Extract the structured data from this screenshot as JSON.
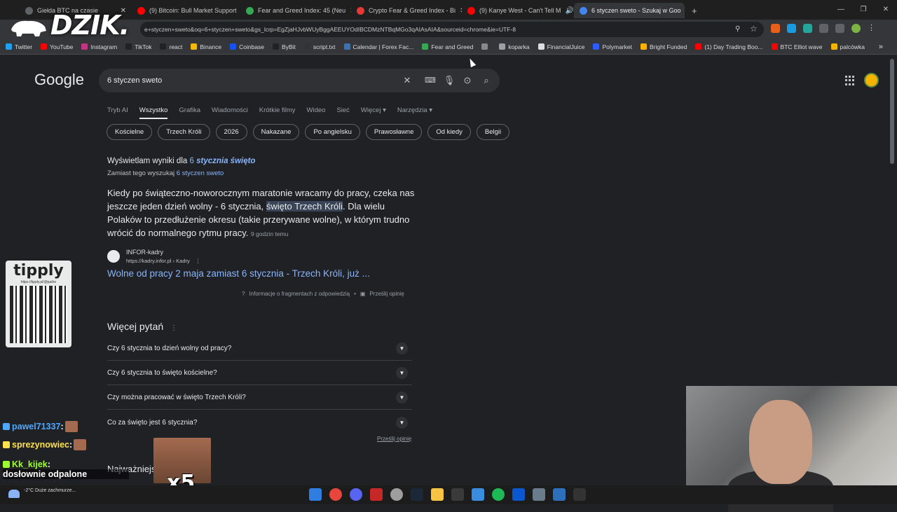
{
  "browser": {
    "tabs": [
      {
        "label": "Giełda BTC na czasie",
        "color": "#5f6368"
      },
      {
        "label": "(9) Bitcoin: Bull Market Support",
        "color": "#ff0000"
      },
      {
        "label": "Fear and Greed Index: 45 (Neu",
        "color": "#34a853"
      },
      {
        "label": "Crypto Fear & Greed Index - Bi",
        "color": "#e53935"
      },
      {
        "label": "(9) Kanye West - Can't Tell M",
        "color": "#ff0000"
      },
      {
        "label": "6 styczen sweto - Szukaj w Goo",
        "color": "#4285f4"
      }
    ],
    "new_tab": "+",
    "url": "e+styczen+sweto&oq=6+styczen+sweto&gs_lcrp=EgZjaHJvbWUyBggAEEUYOdIBCDMzNTBqMGo3qAIAsAIA&sourceid=chrome&ie=UTF-8",
    "bookmarks": [
      {
        "label": "Twitter",
        "color": "#1da1f2"
      },
      {
        "label": "YouTube",
        "color": "#ff0000"
      },
      {
        "label": "Instagram",
        "color": "#c13584"
      },
      {
        "label": "TikTok",
        "color": "#222"
      },
      {
        "label": "react",
        "color": "#222"
      },
      {
        "label": "Binance",
        "color": "#f0b90b"
      },
      {
        "label": "Coinbase",
        "color": "#1652f0"
      },
      {
        "label": "ByBit",
        "color": "#222"
      },
      {
        "label": "script.txt",
        "color": "#333"
      },
      {
        "label": "Calendar | Forex Fac...",
        "color": "#3b73b9"
      },
      {
        "label": "Fear and Greed",
        "color": "#34a853"
      },
      {
        "label": "",
        "color": "#888"
      },
      {
        "label": "koparka",
        "color": "#9aa0a6"
      },
      {
        "label": "FinancialJuice",
        "color": "#ddd"
      },
      {
        "label": "Polymarket",
        "color": "#2e5cff"
      },
      {
        "label": "Bright Funded",
        "color": "#ffb000"
      },
      {
        "label": "(1) Day Trading Boo...",
        "color": "#ff0000"
      },
      {
        "label": "BTC Elliot wave",
        "color": "#ff0000"
      },
      {
        "label": "palcówka",
        "color": "#f4b400"
      }
    ]
  },
  "overlay": {
    "logo": "DZIK.",
    "tipply_title": "tipply",
    "tipply_url": "https://tipply.pl/@patlro",
    "chat": [
      {
        "user": "pawel71337",
        "text": "",
        "color": "#4ea7ff"
      },
      {
        "user": "sprezynowiec",
        "text": "",
        "color": "#ffe14d"
      },
      {
        "user": "Kk_kijek",
        "text": "dosłownie odpalone",
        "color": "#9cff2e"
      }
    ],
    "emote_multiplier": "x5",
    "weather": "-2°C Duże zachmurze..."
  },
  "google": {
    "logo": "Google",
    "query": "6 styczen sweto",
    "nav_tabs": [
      "Tryb AI",
      "Wszystko",
      "Grafika",
      "Wiadomości",
      "Krótkie filmy",
      "Wideo",
      "Sieć",
      "Więcej ▾",
      "Narzędzia ▾"
    ],
    "chips": [
      "Kościelne",
      "Trzech Króli",
      "2026",
      "Nakazane",
      "Po angielsku",
      "Prawosławne",
      "Od kiedy",
      "Belgii"
    ],
    "showing_prefix": "Wyświetlam wyniki dla",
    "showing_pre": "6",
    "showing_corrected": "stycznia święto",
    "instead_prefix": "Zamiast tego wyszukaj",
    "instead_query": "6 styczen sweto",
    "snippet_before": "Kiedy po świąteczno-noworocznym maratonie wracamy do pracy, czeka nas jeszcze jeden dzień wolny - 6 stycznia, ",
    "snippet_highlight": "święto Trzech Króli",
    "snippet_after": ". Dla wielu Polaków to przedłużenie okresu (takie przerywane wolne), w którym trudno wrócić do normalnego rytmu pracy.",
    "snippet_time": "9 godzin temu",
    "source_name": "INFOR-kadry",
    "source_url": "https://kadry.infor.pl › Kadry",
    "result_title": "Wolne od pracy 2 maja zamiast 6 stycznia - Trzech Króli, już ...",
    "about_snippets": "Informacje o fragmentach z odpowiedzią",
    "feedback": "Prześlij opinię",
    "paa_title": "Więcej pytań",
    "paa": [
      "Czy 6 stycznia to dzień wolny od pracy?",
      "Czy 6 stycznia to święto kościelne?",
      "Czy można pracować w święto Trzech Króli?",
      "Co za święto jest 6 stycznia?"
    ],
    "feedback2": "Prześlij opinię",
    "next_section": "Najważniejsze"
  }
}
